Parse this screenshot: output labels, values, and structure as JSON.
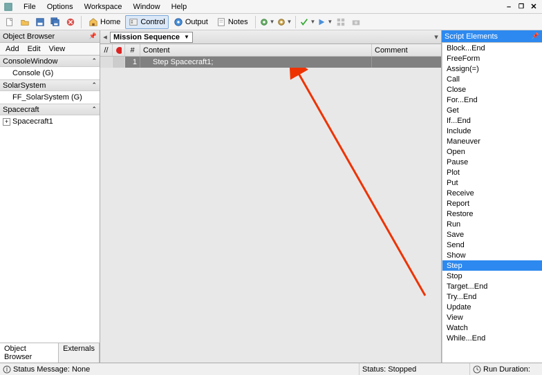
{
  "menu": {
    "items": [
      "File",
      "Options",
      "Workspace",
      "Window",
      "Help"
    ]
  },
  "toolbar": {
    "home": "Home",
    "control": "Control",
    "output": "Output",
    "notes": "Notes"
  },
  "objectBrowser": {
    "title": "Object Browser",
    "actions": [
      "Add",
      "Edit",
      "View"
    ],
    "sections": [
      {
        "name": "ConsoleWindow",
        "items": [
          "Console (G)"
        ]
      },
      {
        "name": "SolarSystem",
        "items": [
          "FF_SolarSystem (G)"
        ]
      },
      {
        "name": "Spacecraft",
        "items": [
          "Spacecraft1"
        ],
        "itemExpandable": true
      }
    ],
    "tabs": [
      "Object Browser",
      "Externals"
    ]
  },
  "missionSequence": {
    "dropdown": "Mission Sequence",
    "headers": {
      "slash": "//",
      "hash": "#",
      "content": "Content",
      "comment": "Comment"
    },
    "rows": [
      {
        "num": "1",
        "content": "Step Spacecraft1;",
        "comment": ""
      }
    ]
  },
  "scriptElements": {
    "title": "Script Elements",
    "items": [
      "Block...End",
      "FreeForm",
      "Assign(=)",
      "Call",
      "Close",
      "For...End",
      "Get",
      "If...End",
      "Include",
      "Maneuver",
      "Open",
      "Pause",
      "Plot",
      "Put",
      "Receive",
      "Report",
      "Restore",
      "Run",
      "Save",
      "Send",
      "Show",
      "Step",
      "Stop",
      "Target...End",
      "Try...End",
      "Update",
      "View",
      "Watch",
      "While...End"
    ],
    "selected": "Step"
  },
  "statusbar": {
    "message_label": "Status Message:",
    "message": "None",
    "state": "Status: Stopped",
    "duration_label": "Run Duration:",
    "duration": ""
  },
  "icons": {
    "new": "new-doc",
    "open": "open",
    "save": "save",
    "saveall": "save-all",
    "delete": "delete",
    "home": "home",
    "control": "control",
    "output": "output",
    "notes": "notes",
    "gear_green": "gear",
    "gear_gold": "gear",
    "check": "check",
    "play": "play",
    "grid": "grid",
    "camera": "camera"
  }
}
